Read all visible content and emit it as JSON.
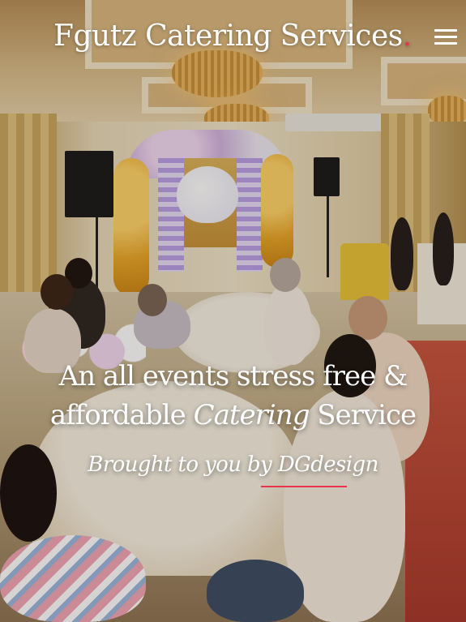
{
  "header": {
    "brand_name": "Fgutz Catering Services",
    "brand_dot": ".",
    "menu_icon": "hamburger-menu-icon"
  },
  "hero": {
    "headline_line1": "An all events stress free &",
    "headline_line2_prefix": "affordable ",
    "headline_line2_italic": "Catering",
    "headline_line2_suffix": " Service",
    "subline": "Brought to you by DGdesign"
  },
  "colors": {
    "accent": "#e8354a",
    "text": "#ffffff"
  }
}
